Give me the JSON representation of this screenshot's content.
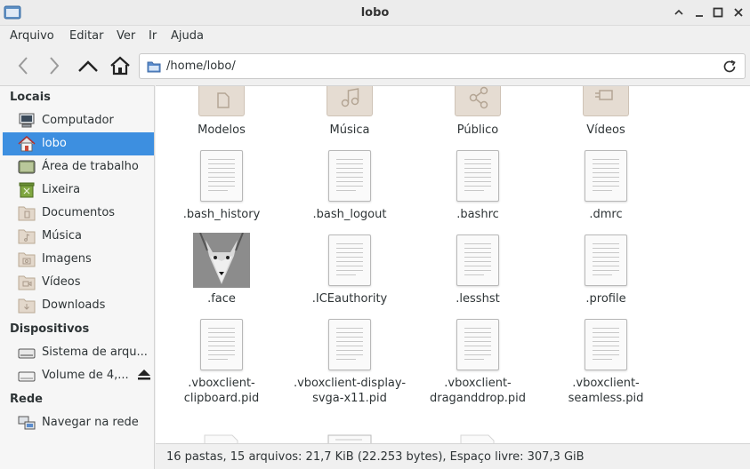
{
  "window": {
    "title": "lobo"
  },
  "menu": [
    "Arquivo",
    "Editar",
    "Ver",
    "Ir",
    "Ajuda"
  ],
  "location": {
    "path": "/home/lobo/"
  },
  "sidebar": {
    "sections": [
      {
        "title": "Locais"
      },
      {
        "title": "Dispositivos"
      },
      {
        "title": "Rede"
      }
    ],
    "items": [
      {
        "label": "Computador",
        "icon": "computer-icon"
      },
      {
        "label": "lobo",
        "icon": "home-icon"
      },
      {
        "label": "Área de trabalho",
        "icon": "desktop-icon"
      },
      {
        "label": "Lixeira",
        "icon": "trash-icon"
      },
      {
        "label": "Documentos",
        "icon": "folder-documents-icon"
      },
      {
        "label": "Música",
        "icon": "folder-music-icon"
      },
      {
        "label": "Imagens",
        "icon": "folder-pictures-icon"
      },
      {
        "label": "Vídeos",
        "icon": "folder-videos-icon"
      },
      {
        "label": "Downloads",
        "icon": "folder-downloads-icon"
      },
      {
        "label": "Sistema de arqu...",
        "icon": "drive-icon"
      },
      {
        "label": "Volume de 4,...",
        "icon": "drive-icon"
      },
      {
        "label": "Navegar na rede",
        "icon": "network-icon"
      }
    ]
  },
  "files": [
    {
      "name": "Modelos",
      "kind": "folder-templates"
    },
    {
      "name": "Música",
      "kind": "folder-music"
    },
    {
      "name": "Público",
      "kind": "folder-public"
    },
    {
      "name": "Vídeos",
      "kind": "folder-videos"
    },
    {
      "name": ".bash_history",
      "kind": "text"
    },
    {
      "name": ".bash_logout",
      "kind": "text"
    },
    {
      "name": ".bashrc",
      "kind": "text"
    },
    {
      "name": ".dmrc",
      "kind": "text"
    },
    {
      "name": ".face",
      "kind": "image"
    },
    {
      "name": ".ICEauthority",
      "kind": "text"
    },
    {
      "name": ".lesshst",
      "kind": "text"
    },
    {
      "name": ".profile",
      "kind": "text"
    },
    {
      "name": ".vboxclient-\nclipboard.pid",
      "kind": "text"
    },
    {
      "name": ".vboxclient-display-\nsvga-x11.pid",
      "kind": "text"
    },
    {
      "name": ".vboxclient-\ndraganddrop.pid",
      "kind": "text"
    },
    {
      "name": ".vboxclient-\nseamless.pid",
      "kind": "text"
    }
  ],
  "status": {
    "text": "16 pastas, 15 arquivos: 21,7 KiB (22.253 bytes), Espaço livre: 307,3 GiB"
  },
  "colors": {
    "selection": "#3d8fe0",
    "folder": "#e5dcd2"
  }
}
